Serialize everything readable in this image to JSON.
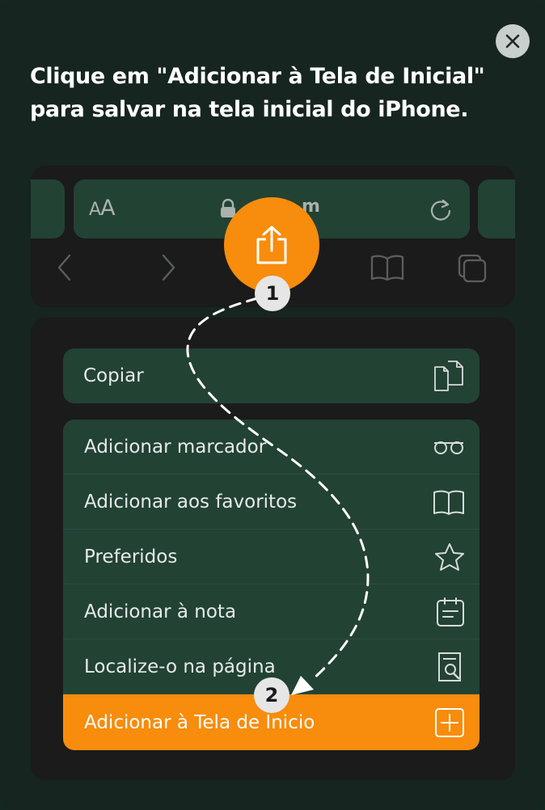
{
  "dialog": {
    "title": "Clique em \"Adicionar à Tela de Inicial\" para salvar na tela inicial do iPhone.",
    "close_icon": "close-icon"
  },
  "browser": {
    "text_size_label_small": "A",
    "text_size_label_large": "A",
    "domain_fragment": "m",
    "icons": [
      "lock-icon",
      "reload-icon",
      "back-icon",
      "forward-icon",
      "share-icon",
      "bookmarks-icon",
      "tabs-icon"
    ]
  },
  "steps": {
    "first": "1",
    "second": "2"
  },
  "share_sheet": {
    "copy": {
      "label": "Copiar",
      "icon": "copy-icon"
    },
    "items": [
      {
        "label": "Adicionar marcador",
        "icon": "glasses-icon"
      },
      {
        "label": "Adicionar aos favoritos",
        "icon": "book-icon"
      },
      {
        "label": "Preferidos",
        "icon": "star-icon"
      },
      {
        "label": "Adicionar à nota",
        "icon": "note-icon"
      },
      {
        "label": "Localize-o na página",
        "icon": "find-on-page-icon"
      },
      {
        "label": "Adicionar à Tela de Inicio",
        "icon": "add-square-icon"
      }
    ]
  },
  "colors": {
    "background": "#16251f",
    "panel": "#1b1b1b",
    "row": "#224234",
    "accent": "#f88c0c"
  }
}
